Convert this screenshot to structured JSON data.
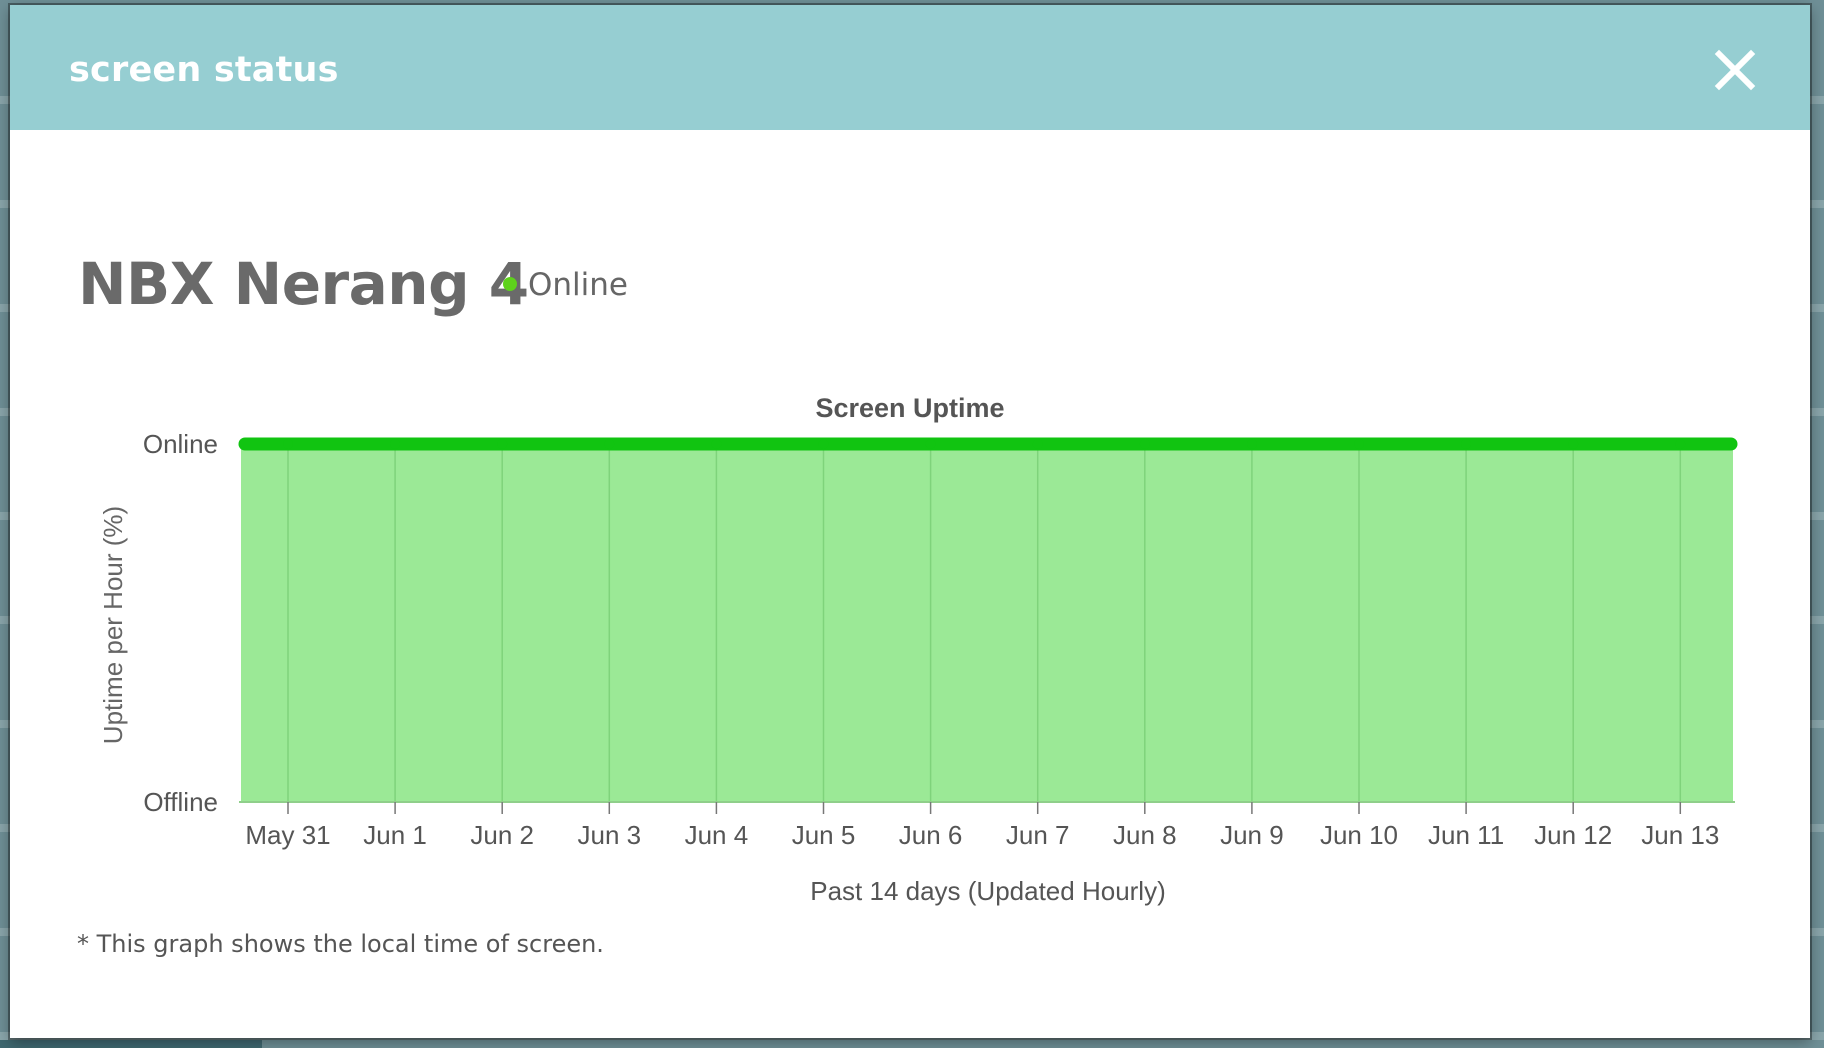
{
  "modal": {
    "title": "screen status",
    "close_icon": "close-icon"
  },
  "screen": {
    "name": "NBX Nerang 4",
    "status": "Online",
    "status_color": "#5ed21b"
  },
  "footnote": "* This graph shows the local time of screen.",
  "colors": {
    "header": "#96ced2",
    "line": "#11c411",
    "area": "#9be996"
  },
  "chart_data": {
    "type": "area",
    "title": "Screen Uptime",
    "xlabel": "Past 14 days (Updated Hourly)",
    "ylabel": "Uptime per Hour (%)",
    "y_tick_labels": [
      "Offline",
      "Online"
    ],
    "ylim": [
      0,
      100
    ],
    "x": [
      "May 31",
      "Jun 1",
      "Jun 2",
      "Jun 3",
      "Jun 4",
      "Jun 5",
      "Jun 6",
      "Jun 7",
      "Jun 8",
      "Jun 9",
      "Jun 10",
      "Jun 11",
      "Jun 12",
      "Jun 13"
    ],
    "series": [
      {
        "values": [
          100,
          100,
          100,
          100,
          100,
          100,
          100,
          100,
          100,
          100,
          100,
          100,
          100,
          100
        ]
      }
    ],
    "grid": true,
    "legend": "none"
  }
}
